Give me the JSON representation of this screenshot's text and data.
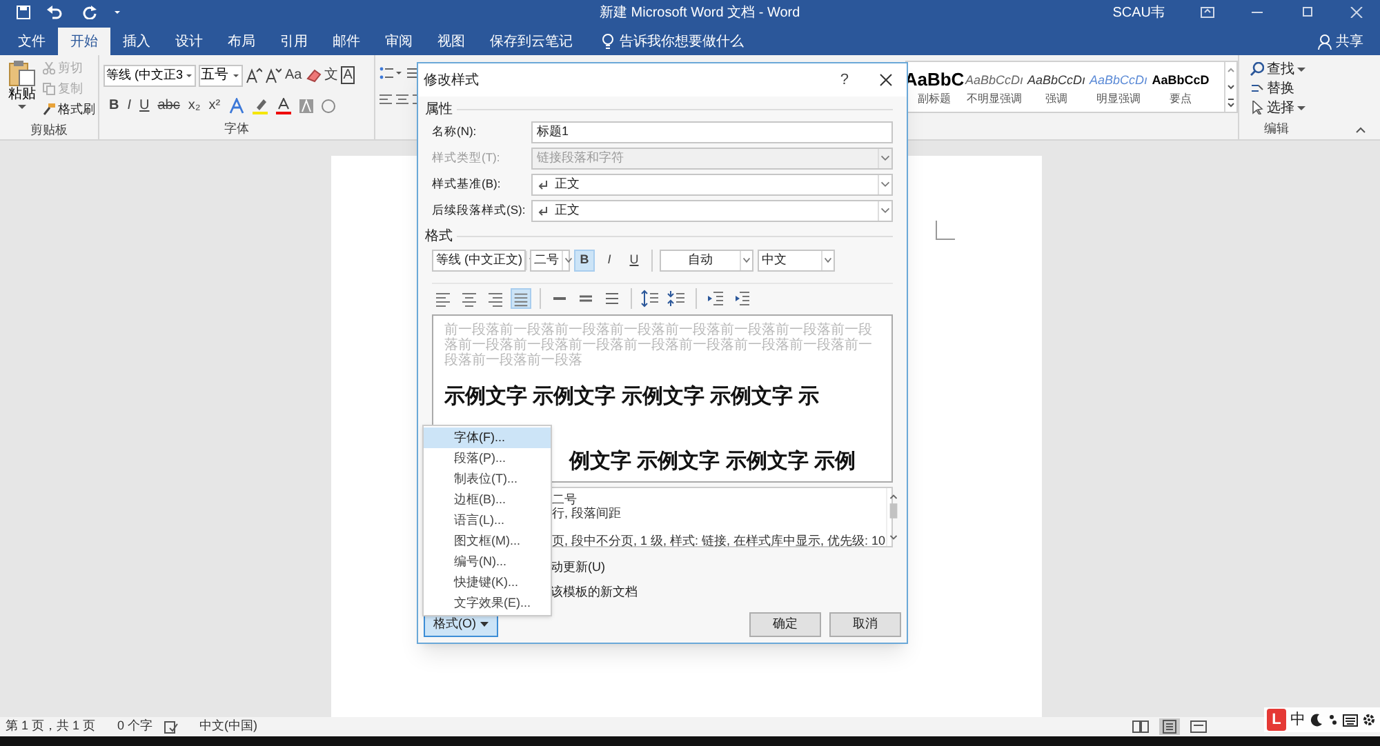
{
  "title_bar": {
    "title": "新建 Microsoft Word 文档 - Word",
    "user": "SCAU韦"
  },
  "tabs": [
    {
      "label": "文件",
      "selected": false
    },
    {
      "label": "开始",
      "selected": true
    },
    {
      "label": "插入",
      "selected": false
    },
    {
      "label": "设计",
      "selected": false
    },
    {
      "label": "布局",
      "selected": false
    },
    {
      "label": "引用",
      "selected": false
    },
    {
      "label": "邮件",
      "selected": false
    },
    {
      "label": "审阅",
      "selected": false
    },
    {
      "label": "视图",
      "selected": false
    },
    {
      "label": "保存到云笔记",
      "selected": false
    }
  ],
  "tell_me": "告诉我你想要做什么",
  "share": "共享",
  "clipboard": {
    "paste": "粘贴",
    "label": "剪贴板",
    "items": [
      {
        "label": "剪切",
        "kind": "cut",
        "disabled": true
      },
      {
        "label": "复制",
        "kind": "copy",
        "disabled": true
      },
      {
        "label": "格式刷",
        "kind": "painter",
        "disabled": false
      }
    ]
  },
  "font_group": {
    "font_name": "等线 (中文正3",
    "font_size": "五号",
    "case_button": "Aa",
    "phonetic": "文",
    "border_char": "A",
    "row2": [
      "B",
      "I",
      "U",
      "abc",
      "x₂",
      "x²"
    ],
    "label": "字体"
  },
  "styles": [
    {
      "sample": "AaBbC",
      "name": "副标题",
      "kind": "subtitle"
    },
    {
      "sample": "AaBbCcDı",
      "name": "不明显强调",
      "kind": "subtle"
    },
    {
      "sample": "AaBbCcDı",
      "name": "强调",
      "kind": "emphasis"
    },
    {
      "sample": "AaBbCcDı",
      "name": "明显强调",
      "kind": "intense"
    },
    {
      "sample": "AaBbCcD",
      "name": "要点",
      "kind": "strong"
    }
  ],
  "editing": {
    "find": "查找",
    "replace": "替换",
    "select": "选择",
    "label": "编辑"
  },
  "dialog": {
    "title": "修改样式",
    "help": "?",
    "properties_label": "属性",
    "fields": [
      {
        "label": "名称(N):",
        "value": "标题1",
        "kind": "text",
        "disabled": false
      },
      {
        "label": "样式类型(T):",
        "value": "链接段落和字符",
        "kind": "select",
        "disabled": true
      },
      {
        "label": "样式基准(B):",
        "value": "正文",
        "kind": "select",
        "disabled": false
      },
      {
        "label": "后续段落样式(S):",
        "value": "正文",
        "kind": "select",
        "disabled": false
      }
    ],
    "format_label": "格式",
    "font": "等线 (中文正文)",
    "size": "二号",
    "toggles": [
      {
        "label": "B",
        "on": true
      },
      {
        "label": "I",
        "on": false
      },
      {
        "label": "U",
        "on": false
      }
    ],
    "text_color_option": "自动",
    "script": "中文",
    "alignments": [
      {
        "kind": "left",
        "selected": false
      },
      {
        "kind": "center",
        "selected": false
      },
      {
        "kind": "right",
        "selected": false
      },
      {
        "kind": "justify",
        "selected": true
      }
    ],
    "preview_previous": "前一段落前一段落前一段落前一段落前一段落前一段落前一段落前一段落前一段落前一段落前一段落前一段落前一段落前一段落前一段落前一段落前一段落前一段落",
    "preview_lines": [
      "示例文字 示例文字 示例文字 示例文字 示",
      "例文字 示例文字 示例文字 示例"
    ],
    "description": [
      "二号",
      "行, 段落间距",
      "页, 段中不分页, 1 级, 样式: 链接, 在样式库中显示, 优先级: 10"
    ],
    "options": [
      "动更新(U)",
      "该模板的新文档"
    ],
    "format_button": "格式(O)",
    "ok": "确定",
    "cancel": "取消"
  },
  "format_menu": [
    {
      "label": "字体(F)...",
      "selected": true
    },
    {
      "label": "段落(P)...",
      "selected": false
    },
    {
      "label": "制表位(T)...",
      "selected": false
    },
    {
      "label": "边框(B)...",
      "selected": false
    },
    {
      "label": "语言(L)...",
      "selected": false
    },
    {
      "label": "图文框(M)...",
      "selected": false
    },
    {
      "label": "编号(N)...",
      "selected": false
    },
    {
      "label": "快捷键(K)...",
      "selected": false
    },
    {
      "label": "文字效果(E)...",
      "selected": false
    }
  ],
  "status_bar": {
    "page": "第 1 页，共 1 页",
    "words": "0 个字",
    "language": "中文(中国)"
  },
  "views": [
    {
      "kind": "read",
      "selected": false
    },
    {
      "kind": "print",
      "selected": true
    },
    {
      "kind": "web",
      "selected": false
    }
  ],
  "ime": {
    "logo": "L",
    "mode": "中"
  }
}
